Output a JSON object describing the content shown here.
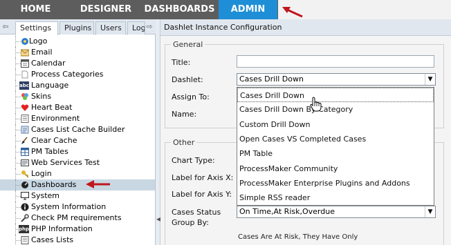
{
  "topnav": {
    "tabs": [
      {
        "label": "HOME"
      },
      {
        "label": "DESIGNER"
      },
      {
        "label": "DASHBOARDS"
      },
      {
        "label": "ADMIN"
      }
    ]
  },
  "left_panel": {
    "tabs": [
      {
        "label": "Settings"
      },
      {
        "label": "Plugins"
      },
      {
        "label": "Users"
      },
      {
        "label": "Log"
      }
    ],
    "tree": [
      {
        "label": "Logo",
        "icon": "logo-icon"
      },
      {
        "label": "Email",
        "icon": "email-icon"
      },
      {
        "label": "Calendar",
        "icon": "calendar-icon"
      },
      {
        "label": "Process Categories",
        "icon": "process-categories-icon"
      },
      {
        "label": "Language",
        "icon": "language-icon",
        "icon_text": "abc"
      },
      {
        "label": "Skins",
        "icon": "skins-icon"
      },
      {
        "label": "Heart Beat",
        "icon": "heart-icon"
      },
      {
        "label": "Environment",
        "icon": "environment-icon"
      },
      {
        "label": "Cases List Cache Builder",
        "icon": "cache-builder-icon"
      },
      {
        "label": "Clear Cache",
        "icon": "broom-icon"
      },
      {
        "label": "PM Tables",
        "icon": "pm-tables-icon"
      },
      {
        "label": "Web Services Test",
        "icon": "web-services-icon"
      },
      {
        "label": "Login",
        "icon": "key-icon"
      },
      {
        "label": "Dashboards",
        "icon": "dashboards-icon"
      },
      {
        "label": "System",
        "icon": "monitor-icon"
      },
      {
        "label": "System Information",
        "icon": "info-icon"
      },
      {
        "label": "Check PM requirements",
        "icon": "wrench-icon"
      },
      {
        "label": "PHP Information",
        "icon": "php-icon",
        "icon_text": "php"
      },
      {
        "label": "Cases Lists",
        "icon": "cases-lists-icon"
      }
    ]
  },
  "right_panel": {
    "title": "Dashlet Instance Configuration",
    "general_legend": "General",
    "other_legend": "Other",
    "labels": {
      "title": "Title:",
      "dashlet": "Dashlet:",
      "assign_to": "Assign To:",
      "name": "Name:",
      "chart_type": "Chart Type:",
      "label_x": "Label for Axis X:",
      "label_y": "Label for Axis Y:",
      "cases_status_1": "Cases Status",
      "cases_status_2": "Group By:"
    },
    "dashlet_value": "Cases Drill Down",
    "cases_status_value": "On Time,At Risk,Overdue",
    "dropdown_options": [
      "Cases Drill Down",
      "Cases Drill Down By Category",
      "Custom Drill Down",
      "Open Cases VS Completed Cases",
      "PM Table",
      "ProcessMaker Community",
      "ProcessMaker Enterprise Plugins and Addons",
      "Simple RSS reader"
    ],
    "bottom_note": "Cases Are At Risk, They Have Only"
  },
  "colors": {
    "nav_bg": "#5d5d5d",
    "nav_active": "#1e8fd6",
    "arrow_red": "#c0161c",
    "selected_row": "#c8d7e2"
  }
}
